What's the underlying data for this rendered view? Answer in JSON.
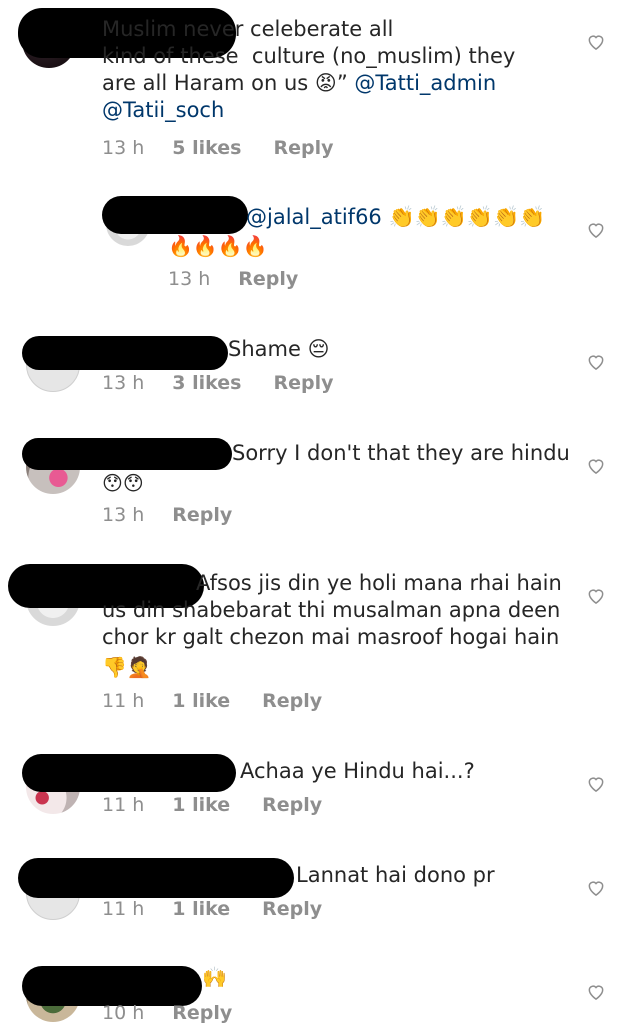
{
  "comments": [
    {
      "text": "Muslim never celeberate all\nkind of these  culture (no_muslim) they\nare all Haram on us ",
      "emoji": "😡",
      "text2": "” ",
      "mention1": "@Tatti_admin",
      "mention2": "@Tatii_soch",
      "time": "13 h",
      "likes": "5 likes",
      "reply": "Reply"
    },
    {
      "mention": "@jalal_atif66",
      "emoji1": "👏👏👏👏👏👏",
      "emoji2": "🔥🔥🔥🔥",
      "time": "13 h",
      "reply": "Reply"
    },
    {
      "text": "Shame ",
      "emoji": "😔",
      "time": "13 h",
      "likes": "3 likes",
      "reply": "Reply"
    },
    {
      "text": "Sorry I don't that they are hindu",
      "emoji": "😯😯",
      "time": "13 h",
      "reply": "Reply"
    },
    {
      "text": "Afsos jis din ye holi mana rhai hain\nus din shabebarat thi musalman apna deen\nchor kr galt chezon mai masroof hogai hain",
      "emoji": "👎🤦",
      "time": "11 h",
      "likes": "1 like",
      "reply": "Reply"
    },
    {
      "text": "Achaa ye Hindu hai...?",
      "time": "11 h",
      "likes": "1 like",
      "reply": "Reply"
    },
    {
      "text": "Lannat hai dono pr",
      "time": "11 h",
      "likes": "1 like",
      "reply": "Reply"
    },
    {
      "emoji": "🙌",
      "time": "10 h",
      "reply": "Reply"
    }
  ],
  "colors": {
    "text": "#262626",
    "meta": "#8e8e8e",
    "mention": "#00376b"
  },
  "icons": {
    "like": "heart-outline-icon"
  }
}
